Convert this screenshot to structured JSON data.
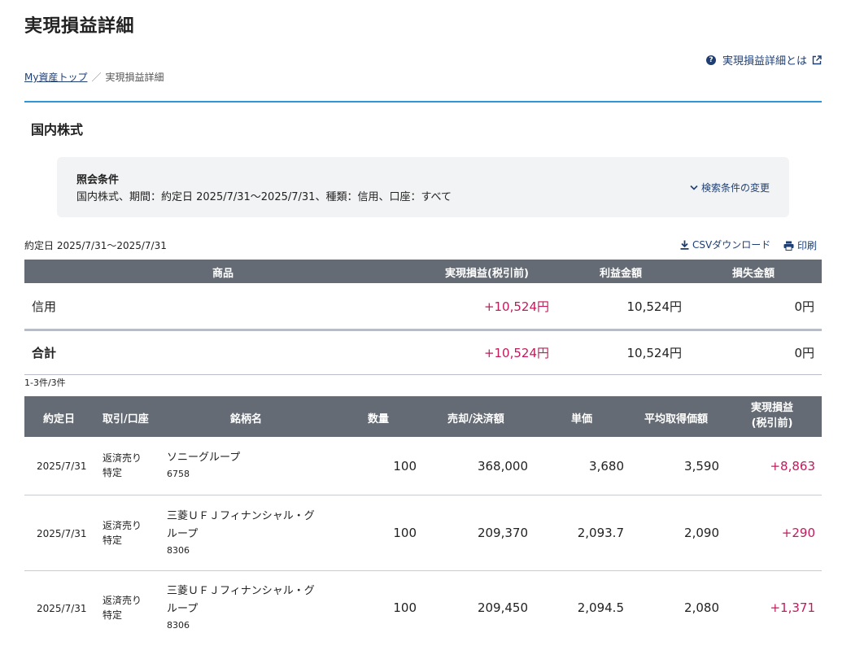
{
  "page": {
    "title": "実現損益詳細",
    "help_label": "実現損益詳細とは"
  },
  "breadcrumb": {
    "home": "My資産トップ",
    "separator": "／",
    "current": "実現損益詳細"
  },
  "section": {
    "title": "国内株式"
  },
  "conditions": {
    "title": "照会条件",
    "text": "国内株式、期間：約定日 2025/7/31〜2025/7/31、種類：信用、口座：すべて",
    "change_label": "検索条件の変更"
  },
  "toolbar": {
    "range": "約定日 2025/7/31〜2025/7/31",
    "csv_label": "CSVダウンロード",
    "print_label": "印刷"
  },
  "summary": {
    "headers": {
      "product": "商品",
      "realized": "実現損益(税引前)",
      "profit": "利益金額",
      "loss": "損失金額"
    },
    "rows": [
      {
        "product": "信用",
        "realized": "+10,524円",
        "profit": "10,524円",
        "loss": "0円"
      }
    ],
    "total": {
      "product": "合計",
      "realized": "+10,524円",
      "profit": "10,524円",
      "loss": "0円"
    }
  },
  "detail": {
    "count": "1-3件/3件",
    "headers": {
      "date": "約定日",
      "type": "取引/口座",
      "name": "銘柄名",
      "qty": "数量",
      "amount": "売却/決済額",
      "price": "単価",
      "avg": "平均取得価額",
      "pl_line1": "実現損益",
      "pl_line2": "(税引前)"
    },
    "rows": [
      {
        "date": "2025/7/31",
        "type1": "返済売り",
        "type2": "特定",
        "name1": "ソニーグループ",
        "name2": "",
        "code": "6758",
        "qty": "100",
        "amount": "368,000",
        "price": "3,680",
        "avg": "3,590",
        "pl": "+8,863"
      },
      {
        "date": "2025/7/31",
        "type1": "返済売り",
        "type2": "特定",
        "name1": "三菱ＵＦＪフィナンシャル・グ",
        "name2": "ループ",
        "code": "8306",
        "qty": "100",
        "amount": "209,370",
        "price": "2,093.7",
        "avg": "2,090",
        "pl": "+290"
      },
      {
        "date": "2025/7/31",
        "type1": "返済売り",
        "type2": "特定",
        "name1": "三菱ＵＦＪフィナンシャル・グ",
        "name2": "ループ",
        "code": "8306",
        "qty": "100",
        "amount": "209,450",
        "price": "2,094.5",
        "avg": "2,080",
        "pl": "+1,371"
      }
    ]
  },
  "colors": {
    "gain": "#c3195d",
    "link": "#1f3f73",
    "header_bg": "#656b74",
    "accent_rule": "#2f95d8"
  },
  "icons": [
    "help-icon",
    "external-link-icon",
    "chevron-down-icon",
    "download-icon",
    "print-icon"
  ]
}
